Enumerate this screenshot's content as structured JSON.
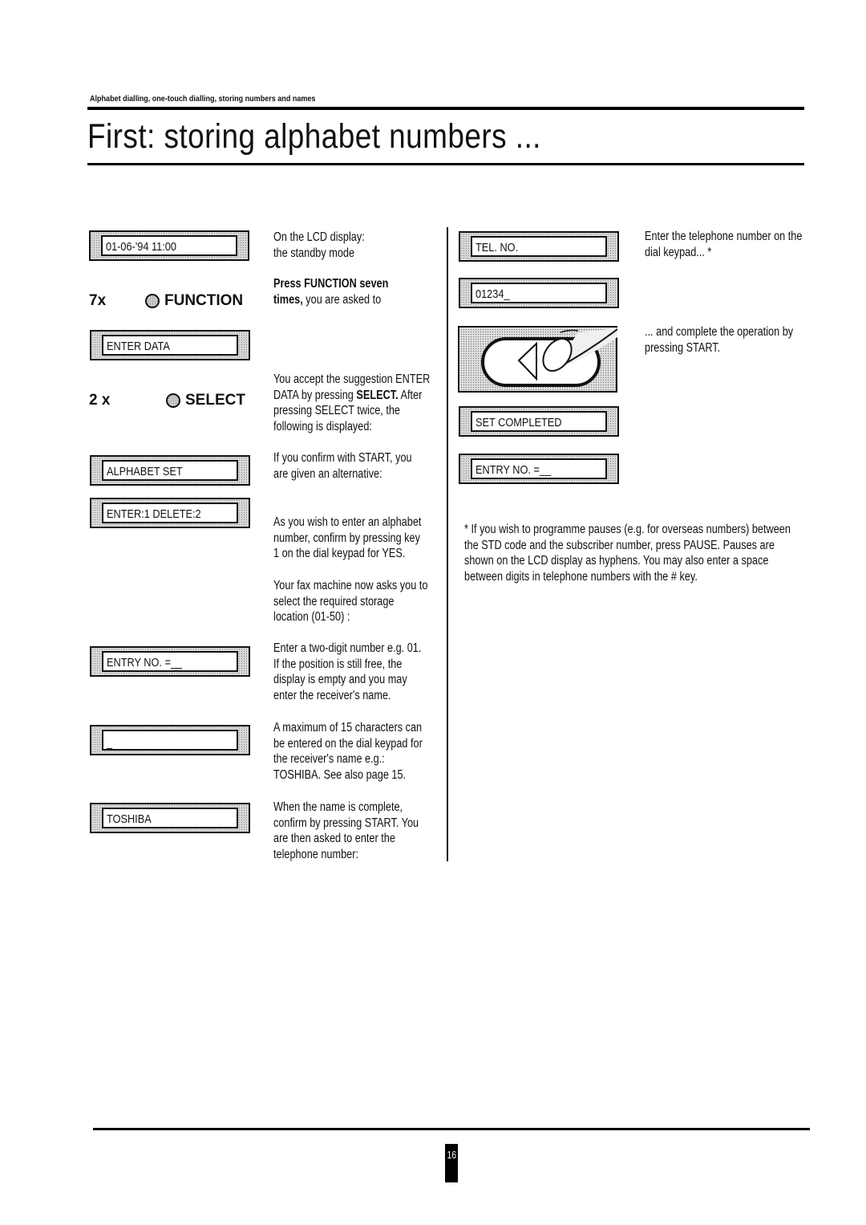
{
  "header": {
    "section_label": "Alphabet dialling, one-touch dialling, storing numbers and names",
    "title": "First: storing alphabet numbers ..."
  },
  "left_column": {
    "lcd_standby": "01-06-'94 11:00",
    "key_function": {
      "count": "7x",
      "label": "FUNCTION",
      "icon": "round-key-icon"
    },
    "lcd_enter_data": "ENTER DATA",
    "key_select": {
      "count": "2 x",
      "label": "SELECT",
      "icon": "round-key-icon"
    },
    "lcd_alphabet_set": "ALPHABET SET",
    "lcd_enter_delete": "ENTER:1 DELETE:2",
    "lcd_entry_no": "ENTRY NO. =__",
    "lcd_cursor": "_",
    "lcd_name": "TOSHIBA"
  },
  "descriptions": {
    "standby": [
      "On the LCD display:",
      "the standby mode"
    ],
    "press_function": {
      "bold_1": "Press FUNCTION seven",
      "bold_2": "times,",
      "rest": " you are asked to"
    },
    "select": {
      "line1": "You accept the suggestion ENTER",
      "line2_pre": "DATA by pressing ",
      "line2_bold": "SELECT.",
      "line2_post": " After",
      "line3": "pressing SELECT twice, the",
      "line4": "following is displayed:"
    },
    "confirm_start": [
      "If you confirm with START, you",
      "are given an alternative:"
    ],
    "alphabet_number": [
      "As you wish to enter an alphabet",
      "number, confirm by pressing key",
      "1 on the dial keypad for YES."
    ],
    "storage_location": [
      "Your fax machine now asks you to",
      "select the required storage",
      "location (01-50) :"
    ],
    "two_digit": [
      "Enter a two-digit number e.g. 01.",
      "If the position is still free, the",
      "display is empty and you may",
      "enter the receiver's name."
    ],
    "max_chars": [
      "A maximum of 15 characters can",
      "be entered on the dial keypad for",
      "the receiver's name e.g.:",
      "TOSHIBA. See also page 15."
    ],
    "name_complete": [
      "When the name is complete,",
      "confirm by pressing START. You",
      "are then asked to enter the",
      "telephone number:"
    ]
  },
  "right_column": {
    "lcd_tel_no": "TEL. NO.",
    "lcd_number": "01234_",
    "tel_desc": [
      "Enter the telephone number on the",
      "dial keypad... *"
    ],
    "start_illustration": "start-key-press-icon",
    "start_desc": [
      "... and complete the operation by",
      "pressing START."
    ],
    "lcd_set_completed": "SET COMPLETED",
    "lcd_entry_no": "ENTRY NO. =__",
    "footnote": [
      "* If you wish to programme pauses (e.g. for overseas numbers) between",
      "the STD code and the subscriber number, press PAUSE. Pauses are",
      "shown on the LCD display as hyphens. You may also enter a space",
      "between digits in telephone numbers with the # key."
    ]
  },
  "footer": {
    "page_number": "16"
  }
}
